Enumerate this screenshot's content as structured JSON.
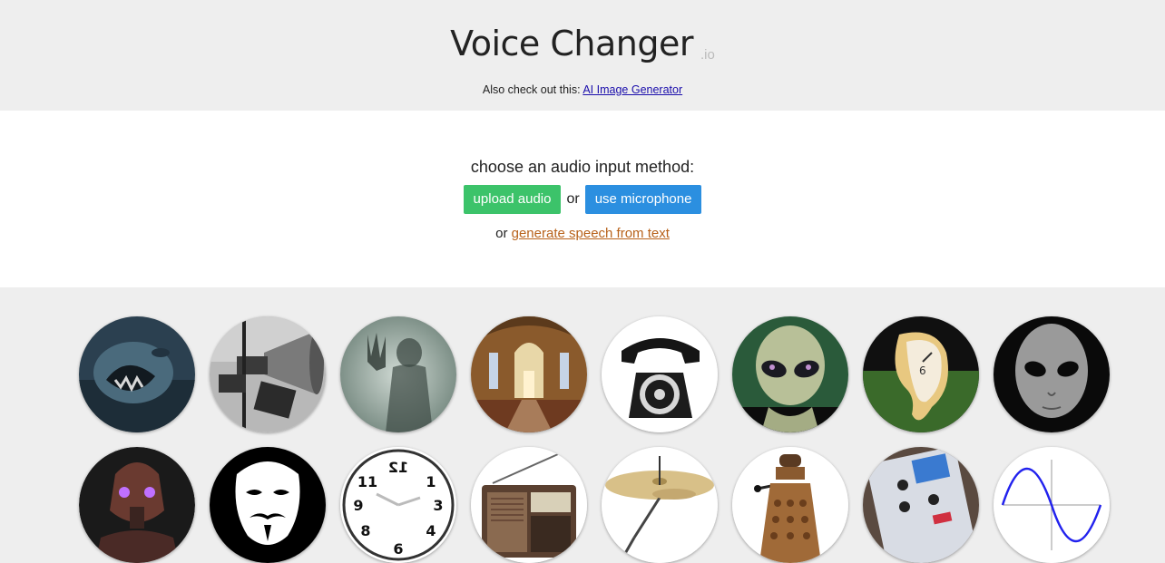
{
  "header": {
    "title": "Voice Changer",
    "title_suffix": ".io",
    "also_prefix": "Also check out this: ",
    "also_link": "AI Image Generator"
  },
  "input": {
    "prompt": "choose an audio input method:",
    "upload_label": "upload audio",
    "or_label": "or",
    "mic_label": "use microphone",
    "or_prefix": "or",
    "tts_link": "generate speech from text"
  },
  "voices": [
    {
      "icon": "monster-icon"
    },
    {
      "icon": "megaphone-icon"
    },
    {
      "icon": "ghost-icon"
    },
    {
      "icon": "church-icon"
    },
    {
      "icon": "telephone-icon"
    },
    {
      "icon": "alien-icon"
    },
    {
      "icon": "melting-clock-icon"
    },
    {
      "icon": "grey-alien-icon"
    },
    {
      "icon": "robot-icon"
    },
    {
      "icon": "anonymous-mask-icon"
    },
    {
      "icon": "reverse-clock-icon"
    },
    {
      "icon": "radio-icon"
    },
    {
      "icon": "cymbal-icon"
    },
    {
      "icon": "dalek-icon"
    },
    {
      "icon": "synth-pedal-icon"
    },
    {
      "icon": "sine-wave-icon"
    }
  ],
  "colors": {
    "upload": "#3cc36a",
    "mic": "#2b8fe0",
    "link": "#b8621b"
  }
}
